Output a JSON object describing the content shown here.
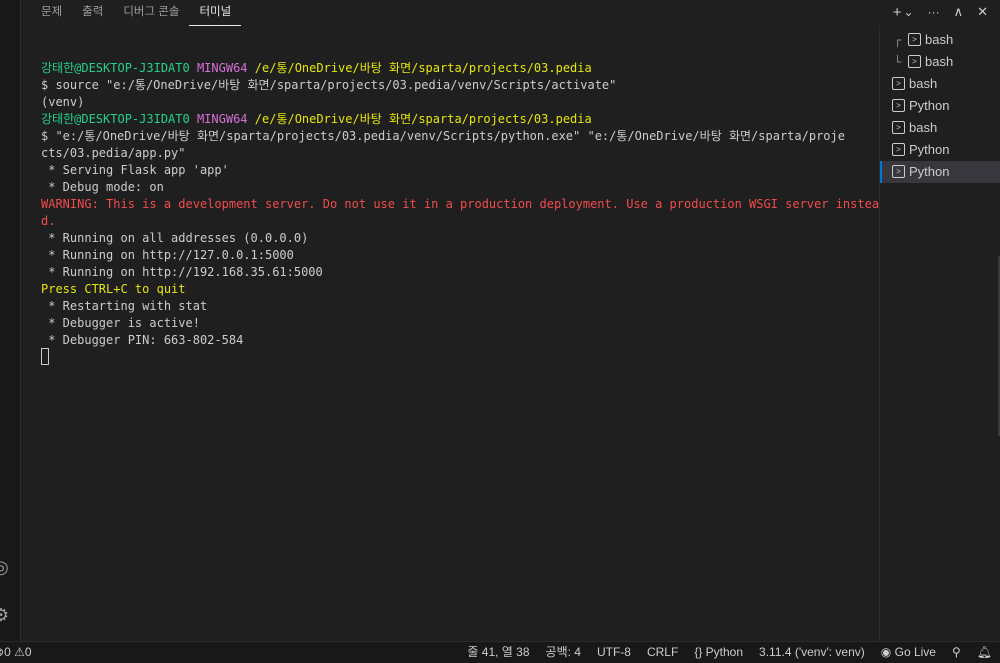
{
  "tabs": [
    {
      "label": "문제"
    },
    {
      "label": "출력"
    },
    {
      "label": "디버그 콘솔"
    },
    {
      "label": "터미널"
    }
  ],
  "top_actions": {
    "add": "+",
    "dropdown": "⌄",
    "more": "···",
    "maximize": "∧",
    "close": "✕"
  },
  "terminal": {
    "prompt1_user": "강태한@DESKTOP-J3IDAT0",
    "prompt1_env": "MINGW64",
    "prompt1_path": "/e/통/OneDrive/바탕 화면/sparta/projects/03.pedia",
    "cmd1": "$ source \"e:/통/OneDrive/바탕 화면/sparta/projects/03.pedia/venv/Scripts/activate\"",
    "venv": "(venv)",
    "prompt2_user": "강태한@DESKTOP-J3IDAT0",
    "prompt2_env": "MINGW64",
    "prompt2_path": "/e/통/OneDrive/바탕 화면/sparta/projects/03.pedia",
    "cmd2_line1": "$ \"e:/통/OneDrive/바탕 화면/sparta/projects/03.pedia/venv/Scripts/python.exe\" \"e:/통/OneDrive/바탕 화면/sparta/proje",
    "cmd2_line2": "cts/03.pedia/app.py\"",
    "out1": " * Serving Flask app 'app'",
    "out2": " * Debug mode: on",
    "warning_line1": "WARNING: This is a development server. Do not use it in a production deployment. Use a production WSGI server instea",
    "warning_line2": "d.",
    "out3": " * Running on all addresses (0.0.0.0)",
    "out4": " * Running on http://127.0.0.1:5000",
    "out5": " * Running on http://192.168.35.61:5000",
    "quit": "Press CTRL+C to quit",
    "out6": " * Restarting with stat",
    "out7": " * Debugger is active!",
    "out8": " * Debugger PIN: 663-802-584"
  },
  "terminals": [
    {
      "label": "bash",
      "tree": "┌"
    },
    {
      "label": "bash",
      "tree": "└"
    },
    {
      "label": "bash",
      "tree": ""
    },
    {
      "label": "Python",
      "tree": ""
    },
    {
      "label": "bash",
      "tree": ""
    },
    {
      "label": "Python",
      "tree": ""
    },
    {
      "label": "Python",
      "tree": ""
    }
  ],
  "status": {
    "problems": "0",
    "warnings": "0",
    "position": "줄 41, 열 38",
    "spaces": "공백: 4",
    "encoding": "UTF-8",
    "eol": "CRLF",
    "language": "Python",
    "interpreter": "3.11.4 ('venv': venv)",
    "golive": "Go Live"
  },
  "colors": {
    "accent": "#0078d4",
    "green": "#23d18b",
    "magenta": "#d670d6",
    "yellow": "#e5e510",
    "red": "#f14c4c"
  }
}
